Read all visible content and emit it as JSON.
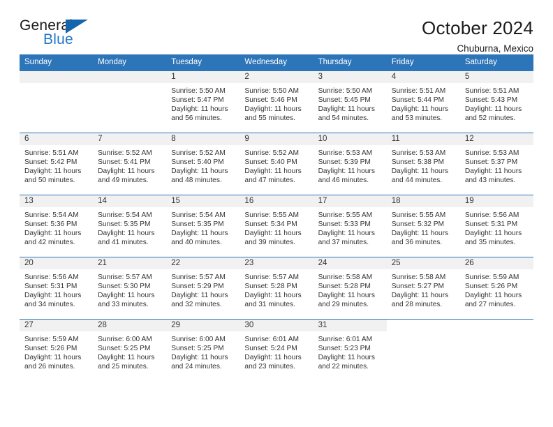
{
  "brand": {
    "word1": "General",
    "word2": "Blue",
    "triangle_color": "#1565ad",
    "blue_color": "#2078c8"
  },
  "header": {
    "title": "October 2024",
    "subtitle": "Chuburna, Mexico"
  },
  "theme": {
    "header_blue": "#2c75b8",
    "daynum_band": "#f1f1f1",
    "text": "#333333"
  },
  "weekday_headers": [
    "Sunday",
    "Monday",
    "Tuesday",
    "Wednesday",
    "Thursday",
    "Friday",
    "Saturday"
  ],
  "weeks": [
    [
      {
        "day": "",
        "state": "empty",
        "sunrise": "",
        "sunset": "",
        "daylight1": "",
        "daylight2": ""
      },
      {
        "day": "",
        "state": "empty",
        "sunrise": "",
        "sunset": "",
        "daylight1": "",
        "daylight2": ""
      },
      {
        "day": "1",
        "state": "filled",
        "sunrise": "Sunrise: 5:50 AM",
        "sunset": "Sunset: 5:47 PM",
        "daylight1": "Daylight: 11 hours",
        "daylight2": "and 56 minutes."
      },
      {
        "day": "2",
        "state": "filled",
        "sunrise": "Sunrise: 5:50 AM",
        "sunset": "Sunset: 5:46 PM",
        "daylight1": "Daylight: 11 hours",
        "daylight2": "and 55 minutes."
      },
      {
        "day": "3",
        "state": "filled",
        "sunrise": "Sunrise: 5:50 AM",
        "sunset": "Sunset: 5:45 PM",
        "daylight1": "Daylight: 11 hours",
        "daylight2": "and 54 minutes."
      },
      {
        "day": "4",
        "state": "filled",
        "sunrise": "Sunrise: 5:51 AM",
        "sunset": "Sunset: 5:44 PM",
        "daylight1": "Daylight: 11 hours",
        "daylight2": "and 53 minutes."
      },
      {
        "day": "5",
        "state": "filled",
        "sunrise": "Sunrise: 5:51 AM",
        "sunset": "Sunset: 5:43 PM",
        "daylight1": "Daylight: 11 hours",
        "daylight2": "and 52 minutes."
      }
    ],
    [
      {
        "day": "6",
        "state": "filled",
        "sunrise": "Sunrise: 5:51 AM",
        "sunset": "Sunset: 5:42 PM",
        "daylight1": "Daylight: 11 hours",
        "daylight2": "and 50 minutes."
      },
      {
        "day": "7",
        "state": "filled",
        "sunrise": "Sunrise: 5:52 AM",
        "sunset": "Sunset: 5:41 PM",
        "daylight1": "Daylight: 11 hours",
        "daylight2": "and 49 minutes."
      },
      {
        "day": "8",
        "state": "filled",
        "sunrise": "Sunrise: 5:52 AM",
        "sunset": "Sunset: 5:40 PM",
        "daylight1": "Daylight: 11 hours",
        "daylight2": "and 48 minutes."
      },
      {
        "day": "9",
        "state": "filled",
        "sunrise": "Sunrise: 5:52 AM",
        "sunset": "Sunset: 5:40 PM",
        "daylight1": "Daylight: 11 hours",
        "daylight2": "and 47 minutes."
      },
      {
        "day": "10",
        "state": "filled",
        "sunrise": "Sunrise: 5:53 AM",
        "sunset": "Sunset: 5:39 PM",
        "daylight1": "Daylight: 11 hours",
        "daylight2": "and 46 minutes."
      },
      {
        "day": "11",
        "state": "filled",
        "sunrise": "Sunrise: 5:53 AM",
        "sunset": "Sunset: 5:38 PM",
        "daylight1": "Daylight: 11 hours",
        "daylight2": "and 44 minutes."
      },
      {
        "day": "12",
        "state": "filled",
        "sunrise": "Sunrise: 5:53 AM",
        "sunset": "Sunset: 5:37 PM",
        "daylight1": "Daylight: 11 hours",
        "daylight2": "and 43 minutes."
      }
    ],
    [
      {
        "day": "13",
        "state": "filled",
        "sunrise": "Sunrise: 5:54 AM",
        "sunset": "Sunset: 5:36 PM",
        "daylight1": "Daylight: 11 hours",
        "daylight2": "and 42 minutes."
      },
      {
        "day": "14",
        "state": "filled",
        "sunrise": "Sunrise: 5:54 AM",
        "sunset": "Sunset: 5:35 PM",
        "daylight1": "Daylight: 11 hours",
        "daylight2": "and 41 minutes."
      },
      {
        "day": "15",
        "state": "filled",
        "sunrise": "Sunrise: 5:54 AM",
        "sunset": "Sunset: 5:35 PM",
        "daylight1": "Daylight: 11 hours",
        "daylight2": "and 40 minutes."
      },
      {
        "day": "16",
        "state": "filled",
        "sunrise": "Sunrise: 5:55 AM",
        "sunset": "Sunset: 5:34 PM",
        "daylight1": "Daylight: 11 hours",
        "daylight2": "and 39 minutes."
      },
      {
        "day": "17",
        "state": "filled",
        "sunrise": "Sunrise: 5:55 AM",
        "sunset": "Sunset: 5:33 PM",
        "daylight1": "Daylight: 11 hours",
        "daylight2": "and 37 minutes."
      },
      {
        "day": "18",
        "state": "filled",
        "sunrise": "Sunrise: 5:55 AM",
        "sunset": "Sunset: 5:32 PM",
        "daylight1": "Daylight: 11 hours",
        "daylight2": "and 36 minutes."
      },
      {
        "day": "19",
        "state": "filled",
        "sunrise": "Sunrise: 5:56 AM",
        "sunset": "Sunset: 5:31 PM",
        "daylight1": "Daylight: 11 hours",
        "daylight2": "and 35 minutes."
      }
    ],
    [
      {
        "day": "20",
        "state": "filled",
        "sunrise": "Sunrise: 5:56 AM",
        "sunset": "Sunset: 5:31 PM",
        "daylight1": "Daylight: 11 hours",
        "daylight2": "and 34 minutes."
      },
      {
        "day": "21",
        "state": "filled",
        "sunrise": "Sunrise: 5:57 AM",
        "sunset": "Sunset: 5:30 PM",
        "daylight1": "Daylight: 11 hours",
        "daylight2": "and 33 minutes."
      },
      {
        "day": "22",
        "state": "filled",
        "sunrise": "Sunrise: 5:57 AM",
        "sunset": "Sunset: 5:29 PM",
        "daylight1": "Daylight: 11 hours",
        "daylight2": "and 32 minutes."
      },
      {
        "day": "23",
        "state": "filled",
        "sunrise": "Sunrise: 5:57 AM",
        "sunset": "Sunset: 5:28 PM",
        "daylight1": "Daylight: 11 hours",
        "daylight2": "and 31 minutes."
      },
      {
        "day": "24",
        "state": "filled",
        "sunrise": "Sunrise: 5:58 AM",
        "sunset": "Sunset: 5:28 PM",
        "daylight1": "Daylight: 11 hours",
        "daylight2": "and 29 minutes."
      },
      {
        "day": "25",
        "state": "filled",
        "sunrise": "Sunrise: 5:58 AM",
        "sunset": "Sunset: 5:27 PM",
        "daylight1": "Daylight: 11 hours",
        "daylight2": "and 28 minutes."
      },
      {
        "day": "26",
        "state": "filled",
        "sunrise": "Sunrise: 5:59 AM",
        "sunset": "Sunset: 5:26 PM",
        "daylight1": "Daylight: 11 hours",
        "daylight2": "and 27 minutes."
      }
    ],
    [
      {
        "day": "27",
        "state": "filled",
        "sunrise": "Sunrise: 5:59 AM",
        "sunset": "Sunset: 5:26 PM",
        "daylight1": "Daylight: 11 hours",
        "daylight2": "and 26 minutes."
      },
      {
        "day": "28",
        "state": "filled",
        "sunrise": "Sunrise: 6:00 AM",
        "sunset": "Sunset: 5:25 PM",
        "daylight1": "Daylight: 11 hours",
        "daylight2": "and 25 minutes."
      },
      {
        "day": "29",
        "state": "filled",
        "sunrise": "Sunrise: 6:00 AM",
        "sunset": "Sunset: 5:25 PM",
        "daylight1": "Daylight: 11 hours",
        "daylight2": "and 24 minutes."
      },
      {
        "day": "30",
        "state": "filled",
        "sunrise": "Sunrise: 6:01 AM",
        "sunset": "Sunset: 5:24 PM",
        "daylight1": "Daylight: 11 hours",
        "daylight2": "and 23 minutes."
      },
      {
        "day": "31",
        "state": "filled",
        "sunrise": "Sunrise: 6:01 AM",
        "sunset": "Sunset: 5:23 PM",
        "daylight1": "Daylight: 11 hours",
        "daylight2": "and 22 minutes."
      },
      {
        "day": "",
        "state": "blank",
        "sunrise": "",
        "sunset": "",
        "daylight1": "",
        "daylight2": ""
      },
      {
        "day": "",
        "state": "blank",
        "sunrise": "",
        "sunset": "",
        "daylight1": "",
        "daylight2": ""
      }
    ]
  ]
}
